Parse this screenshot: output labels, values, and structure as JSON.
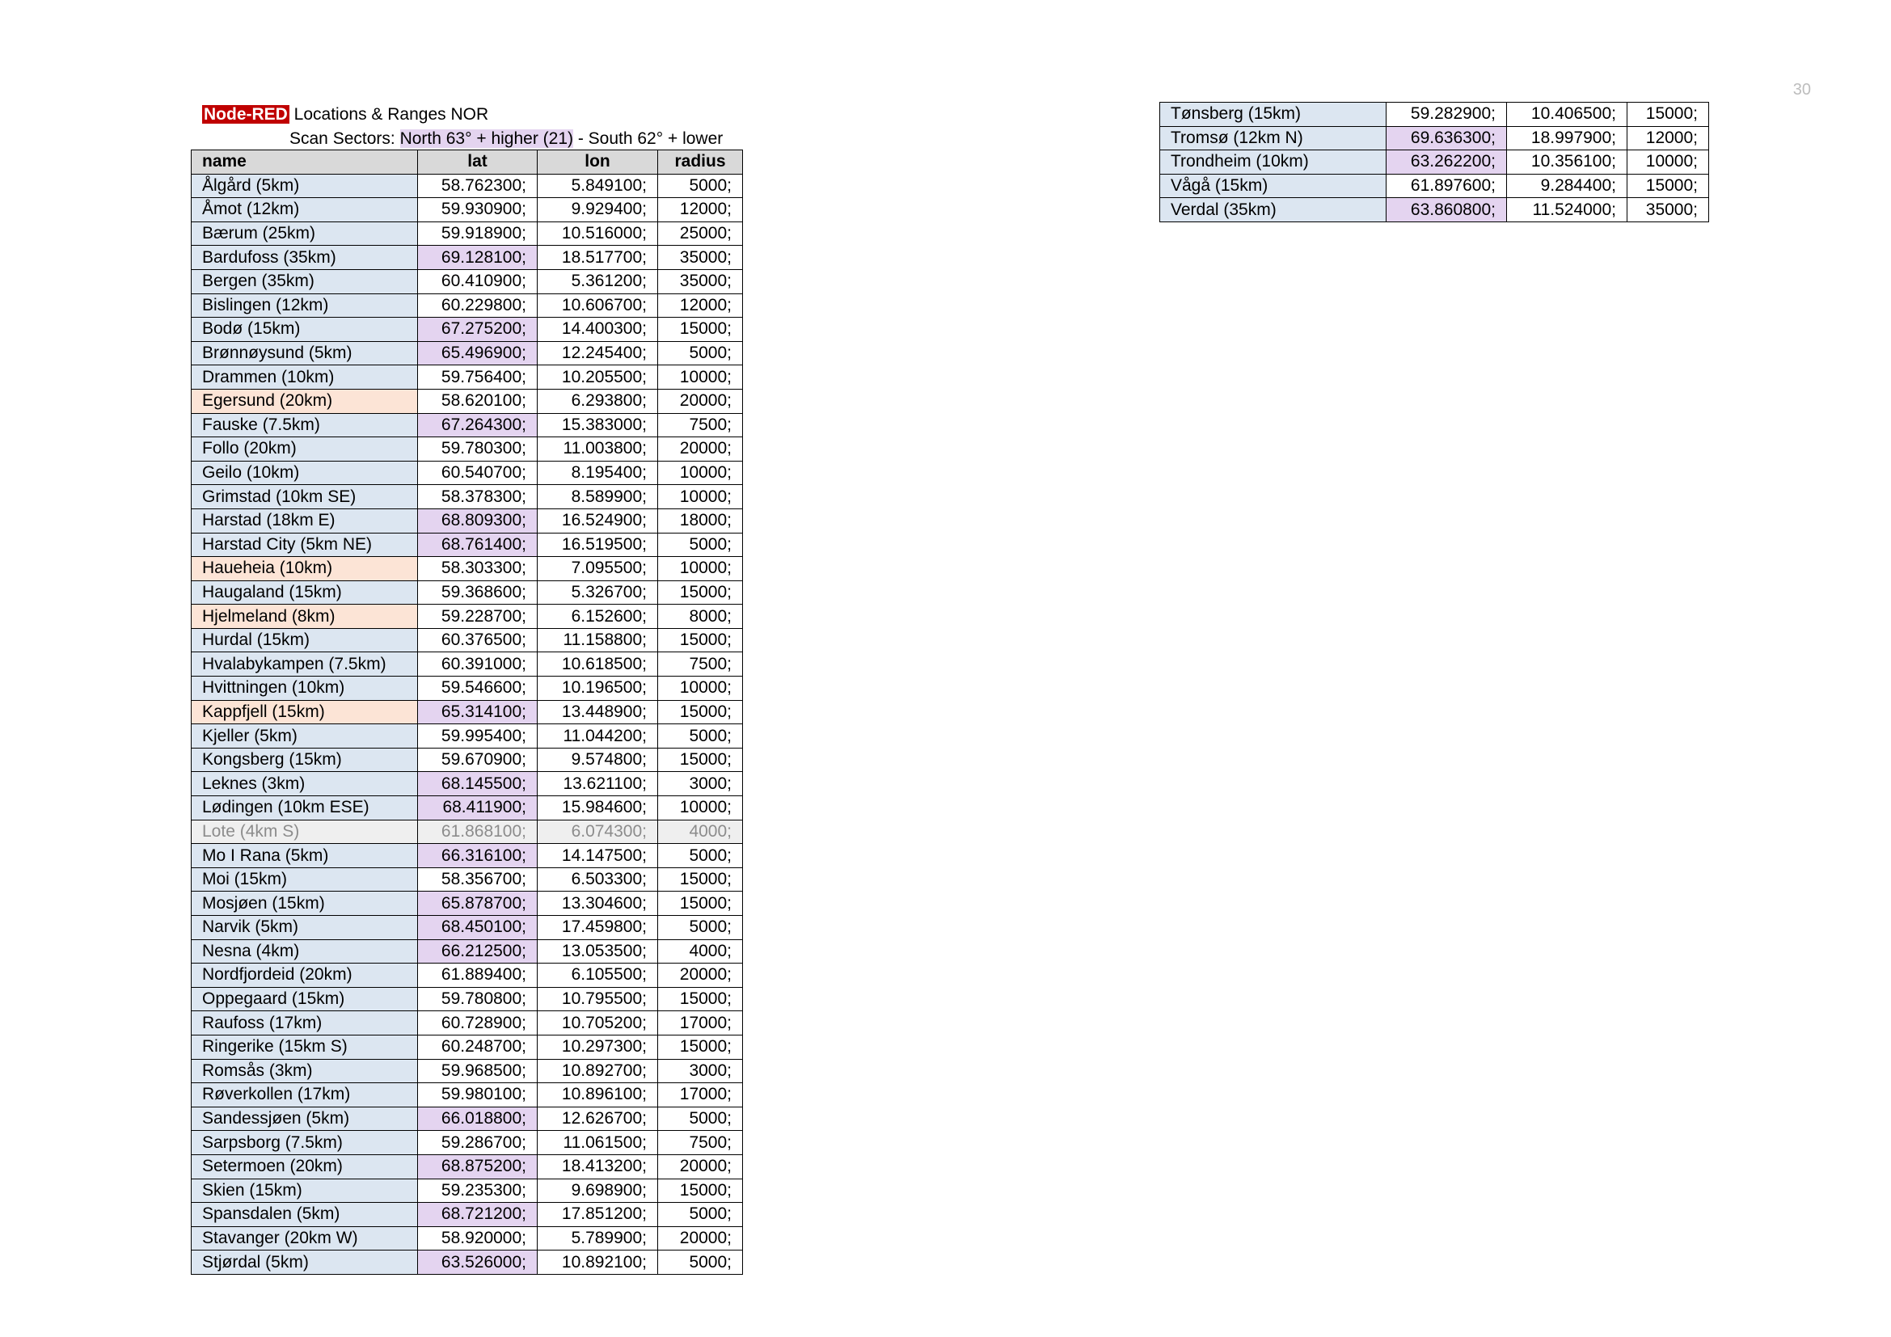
{
  "page_number": "30",
  "header": {
    "brand": "Node-RED",
    "title_rest": " Locations & Ranges NOR",
    "sectors_prefix": "Scan Sectors: ",
    "sector_north": "North 63° + higher (21)",
    "sector_south": " - South 62° + lower"
  },
  "columns": {
    "name": "name",
    "lat": "lat",
    "lon": "lon",
    "radius": "radius"
  },
  "colors": {
    "brand_red": "#c00000",
    "name_cell_blue": "#dce6f1",
    "north_lat_purple": "#e4d4f0",
    "coastal_name_peach": "#fce4d6",
    "inactive_gray": "#efefef",
    "header_gray": "#d9d9d9"
  },
  "locations": [
    {
      "name": "Ålgård (5km)",
      "lat": "58.762300;",
      "lon": "5.849100;",
      "radius": "5000;",
      "north": false,
      "style": "normal"
    },
    {
      "name": "Åmot (12km)",
      "lat": "59.930900;",
      "lon": "9.929400;",
      "radius": "12000;",
      "north": false,
      "style": "normal"
    },
    {
      "name": "Bærum (25km)",
      "lat": "59.918900;",
      "lon": "10.516000;",
      "radius": "25000;",
      "north": false,
      "style": "normal"
    },
    {
      "name": "Bardufoss (35km)",
      "lat": "69.128100;",
      "lon": "18.517700;",
      "radius": "35000;",
      "north": true,
      "style": "normal"
    },
    {
      "name": "Bergen (35km)",
      "lat": "60.410900;",
      "lon": "5.361200;",
      "radius": "35000;",
      "north": false,
      "style": "normal"
    },
    {
      "name": "Bislingen (12km)",
      "lat": "60.229800;",
      "lon": "10.606700;",
      "radius": "12000;",
      "north": false,
      "style": "normal"
    },
    {
      "name": "Bodø (15km)",
      "lat": "67.275200;",
      "lon": "14.400300;",
      "radius": "15000;",
      "north": true,
      "style": "normal"
    },
    {
      "name": "Brønnøysund (5km)",
      "lat": "65.496900;",
      "lon": "12.245400;",
      "radius": "5000;",
      "north": true,
      "style": "normal"
    },
    {
      "name": "Drammen (10km)",
      "lat": "59.756400;",
      "lon": "10.205500;",
      "radius": "10000;",
      "north": false,
      "style": "normal"
    },
    {
      "name": "Egersund (20km)",
      "lat": "58.620100;",
      "lon": "6.293800;",
      "radius": "20000;",
      "north": false,
      "style": "coast"
    },
    {
      "name": "Fauske (7.5km)",
      "lat": "67.264300;",
      "lon": "15.383000;",
      "radius": "7500;",
      "north": true,
      "style": "normal"
    },
    {
      "name": "Follo (20km)",
      "lat": "59.780300;",
      "lon": "11.003800;",
      "radius": "20000;",
      "north": false,
      "style": "normal"
    },
    {
      "name": "Geilo (10km)",
      "lat": "60.540700;",
      "lon": "8.195400;",
      "radius": "10000;",
      "north": false,
      "style": "normal"
    },
    {
      "name": "Grimstad (10km SE)",
      "lat": "58.378300;",
      "lon": "8.589900;",
      "radius": "10000;",
      "north": false,
      "style": "normal"
    },
    {
      "name": "Harstad (18km E)",
      "lat": "68.809300;",
      "lon": "16.524900;",
      "radius": "18000;",
      "north": true,
      "style": "normal"
    },
    {
      "name": "Harstad City (5km NE)",
      "lat": "68.761400;",
      "lon": "16.519500;",
      "radius": "5000;",
      "north": true,
      "style": "normal"
    },
    {
      "name": "Haueheia (10km)",
      "lat": "58.303300;",
      "lon": "7.095500;",
      "radius": "10000;",
      "north": false,
      "style": "coast"
    },
    {
      "name": "Haugaland (15km)",
      "lat": "59.368600;",
      "lon": "5.326700;",
      "radius": "15000;",
      "north": false,
      "style": "normal"
    },
    {
      "name": "Hjelmeland (8km)",
      "lat": "59.228700;",
      "lon": "6.152600;",
      "radius": "8000;",
      "north": false,
      "style": "coast"
    },
    {
      "name": "Hurdal (15km)",
      "lat": "60.376500;",
      "lon": "11.158800;",
      "radius": "15000;",
      "north": false,
      "style": "normal"
    },
    {
      "name": "Hvalabykampen (7.5km)",
      "lat": "60.391000;",
      "lon": "10.618500;",
      "radius": "7500;",
      "north": false,
      "style": "normal"
    },
    {
      "name": "Hvittningen (10km)",
      "lat": "59.546600;",
      "lon": "10.196500;",
      "radius": "10000;",
      "north": false,
      "style": "normal"
    },
    {
      "name": "Kappfjell (15km)",
      "lat": "65.314100;",
      "lon": "13.448900;",
      "radius": "15000;",
      "north": true,
      "style": "coast"
    },
    {
      "name": "Kjeller (5km)",
      "lat": "59.995400;",
      "lon": "11.044200;",
      "radius": "5000;",
      "north": false,
      "style": "normal"
    },
    {
      "name": "Kongsberg (15km)",
      "lat": "59.670900;",
      "lon": "9.574800;",
      "radius": "15000;",
      "north": false,
      "style": "normal"
    },
    {
      "name": "Leknes (3km)",
      "lat": "68.145500;",
      "lon": "13.621100;",
      "radius": "3000;",
      "north": true,
      "style": "normal"
    },
    {
      "name": "Lødingen (10km ESE)",
      "lat": "68.411900;",
      "lon": "15.984600;",
      "radius": "10000;",
      "north": true,
      "style": "normal"
    },
    {
      "name": "Lote (4km S)",
      "lat": "61.868100;",
      "lon": "6.074300;",
      "radius": "4000;",
      "north": false,
      "style": "inactive"
    },
    {
      "name": "Mo I Rana (5km)",
      "lat": "66.316100;",
      "lon": "14.147500;",
      "radius": "5000;",
      "north": true,
      "style": "normal"
    },
    {
      "name": "Moi (15km)",
      "lat": "58.356700;",
      "lon": "6.503300;",
      "radius": "15000;",
      "north": false,
      "style": "normal"
    },
    {
      "name": "Mosjøen (15km)",
      "lat": "65.878700;",
      "lon": "13.304600;",
      "radius": "15000;",
      "north": true,
      "style": "normal"
    },
    {
      "name": "Narvik (5km)",
      "lat": "68.450100;",
      "lon": "17.459800;",
      "radius": "5000;",
      "north": true,
      "style": "normal"
    },
    {
      "name": "Nesna  (4km)",
      "lat": "66.212500;",
      "lon": "13.053500;",
      "radius": "4000;",
      "north": true,
      "style": "normal"
    },
    {
      "name": "Nordfjordeid (20km)",
      "lat": "61.889400;",
      "lon": "6.105500;",
      "radius": "20000;",
      "north": false,
      "style": "normal"
    },
    {
      "name": "Oppegaard (15km)",
      "lat": "59.780800;",
      "lon": "10.795500;",
      "radius": "15000;",
      "north": false,
      "style": "normal"
    },
    {
      "name": "Raufoss (17km)",
      "lat": "60.728900;",
      "lon": "10.705200;",
      "radius": "17000;",
      "north": false,
      "style": "normal"
    },
    {
      "name": "Ringerike (15km S)",
      "lat": "60.248700;",
      "lon": "10.297300;",
      "radius": "15000;",
      "north": false,
      "style": "normal"
    },
    {
      "name": "Romsås (3km)",
      "lat": "59.968500;",
      "lon": "10.892700;",
      "radius": "3000;",
      "north": false,
      "style": "normal"
    },
    {
      "name": "Røverkollen (17km)",
      "lat": "59.980100;",
      "lon": "10.896100;",
      "radius": "17000;",
      "north": false,
      "style": "normal"
    },
    {
      "name": "Sandessjøen (5km)",
      "lat": "66.018800;",
      "lon": "12.626700;",
      "radius": "5000;",
      "north": true,
      "style": "normal"
    },
    {
      "name": "Sarpsborg (7.5km)",
      "lat": "59.286700;",
      "lon": "11.061500;",
      "radius": "7500;",
      "north": false,
      "style": "normal"
    },
    {
      "name": "Setermoen (20km)",
      "lat": "68.875200;",
      "lon": "18.413200;",
      "radius": "20000;",
      "north": true,
      "style": "normal"
    },
    {
      "name": "Skien (15km)",
      "lat": "59.235300;",
      "lon": "9.698900;",
      "radius": "15000;",
      "north": false,
      "style": "normal"
    },
    {
      "name": "Spansdalen (5km)",
      "lat": "68.721200;",
      "lon": "17.851200;",
      "radius": "5000;",
      "north": true,
      "style": "normal"
    },
    {
      "name": "Stavanger (20km W)",
      "lat": "58.920000;",
      "lon": "5.789900;",
      "radius": "20000;",
      "north": false,
      "style": "normal"
    },
    {
      "name": "Stjørdal (5km)",
      "lat": "63.526000;",
      "lon": "10.892100;",
      "radius": "5000;",
      "north": true,
      "style": "normal"
    }
  ],
  "locations_continued": [
    {
      "name": "Tønsberg (15km)",
      "lat": "59.282900;",
      "lon": "10.406500;",
      "radius": "15000;",
      "north": false,
      "style": "normal"
    },
    {
      "name": "Tromsø (12km N)",
      "lat": "69.636300;",
      "lon": "18.997900;",
      "radius": "12000;",
      "north": true,
      "style": "normal"
    },
    {
      "name": "Trondheim (10km)",
      "lat": "63.262200;",
      "lon": "10.356100;",
      "radius": "10000;",
      "north": true,
      "style": "normal"
    },
    {
      "name": "Vågå (15km)",
      "lat": "61.897600;",
      "lon": "9.284400;",
      "radius": "15000;",
      "north": false,
      "style": "normal"
    },
    {
      "name": "Verdal (35km)",
      "lat": "63.860800;",
      "lon": "11.524000;",
      "radius": "35000;",
      "north": true,
      "style": "normal"
    }
  ]
}
